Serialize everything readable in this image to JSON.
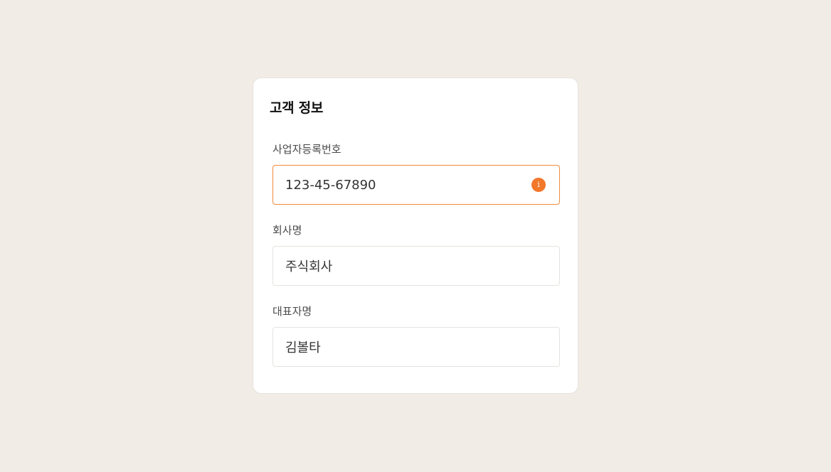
{
  "card": {
    "title": "고객 정보"
  },
  "fields": [
    {
      "label": "사업자등록번호",
      "value": "123-45-67890",
      "state": "warning",
      "icon": "info-icon"
    },
    {
      "label": "회사명",
      "value": "주식회사"
    },
    {
      "label": "대표자명",
      "value": "김볼타"
    }
  ],
  "colors": {
    "background": "#f1ece6",
    "card": "#ffffff",
    "warning_border": "#f08a3a",
    "warning_icon": "#f2782a"
  }
}
